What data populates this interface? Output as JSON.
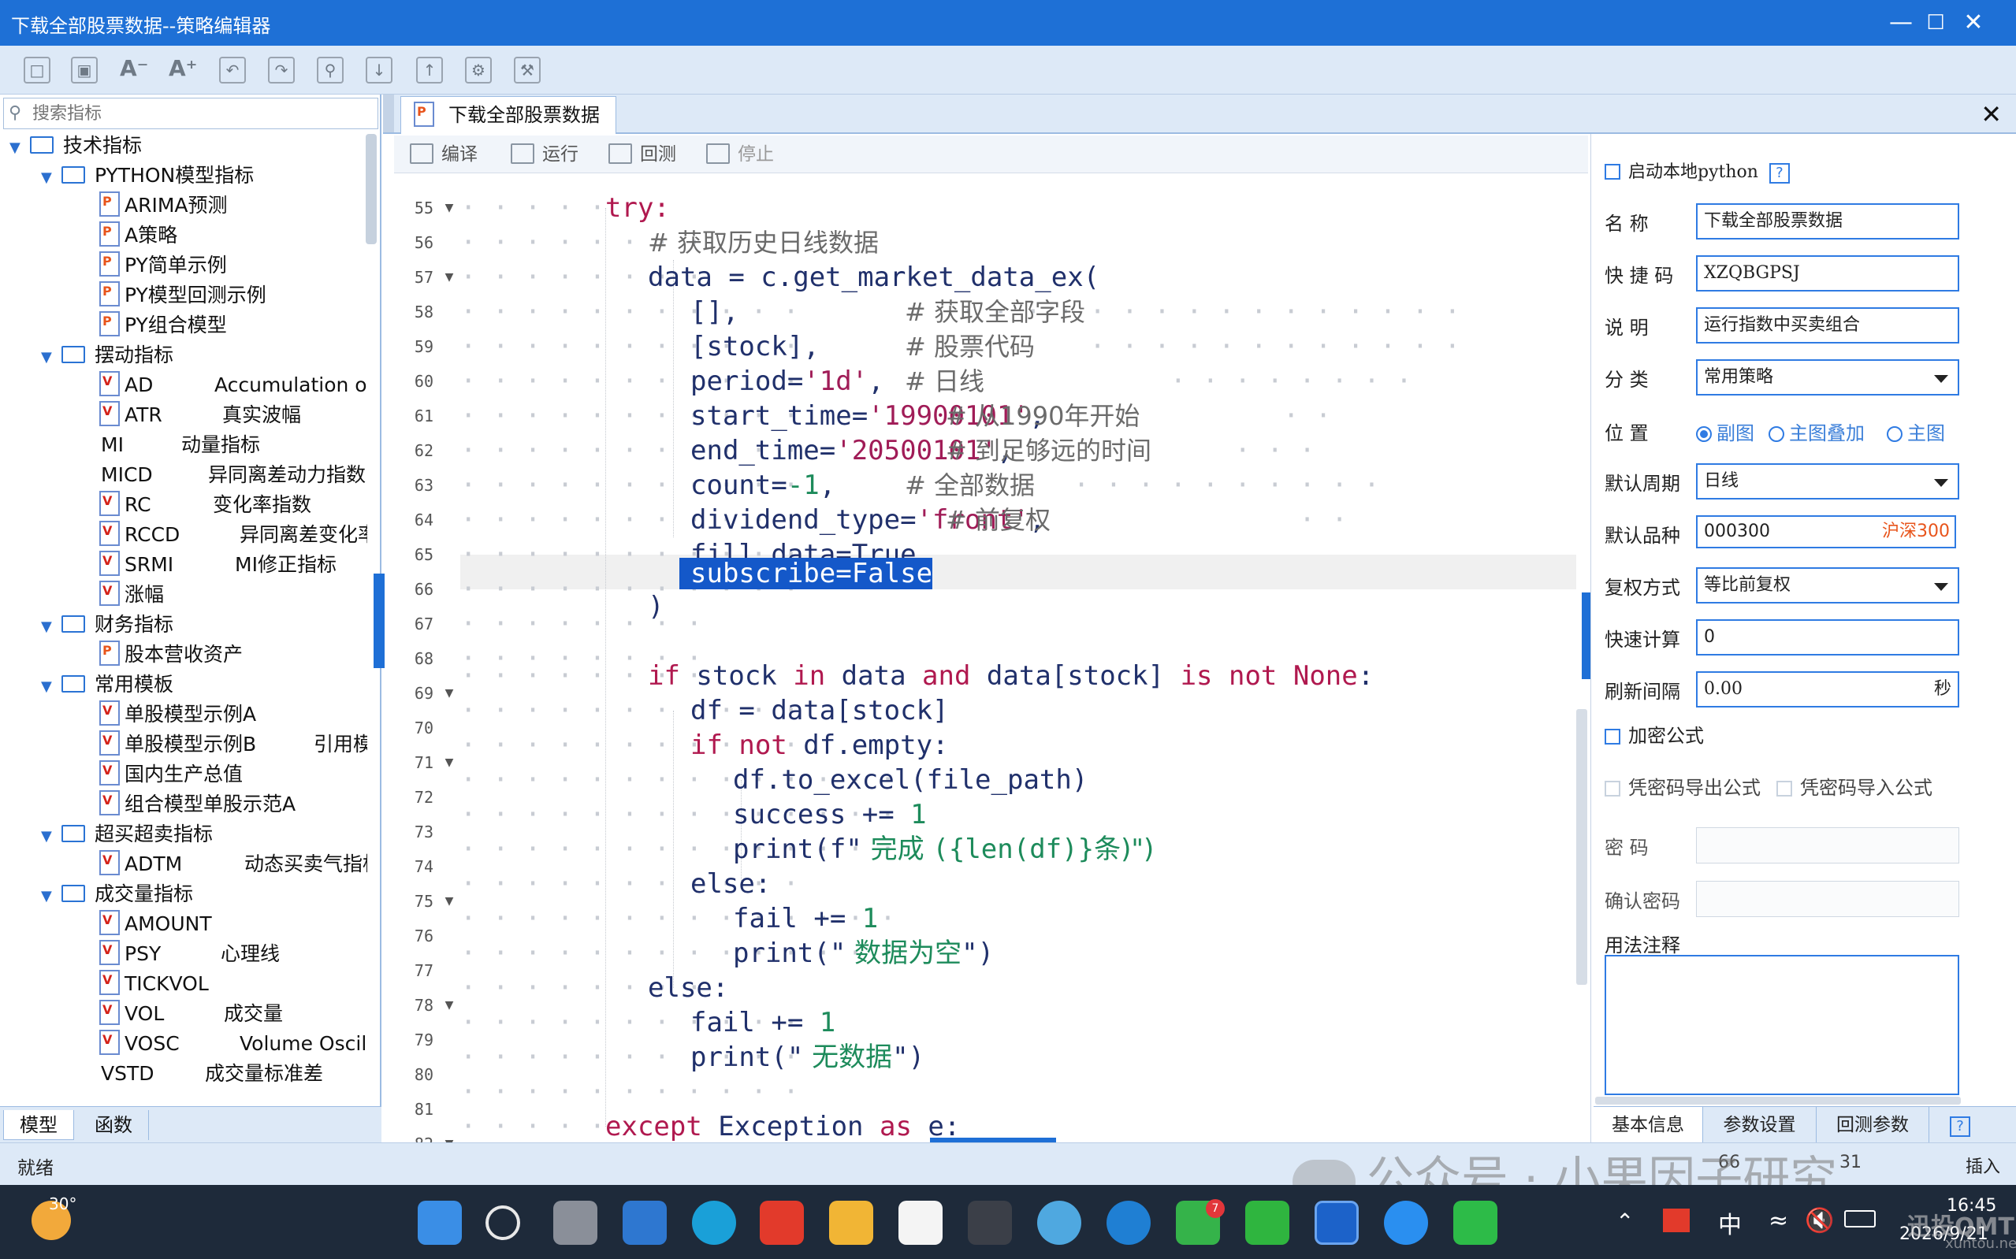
{
  "window": {
    "title": "下载全部股票数据--策略编辑器"
  },
  "toolbar": {
    "icons": [
      "save-icon",
      "save-all-icon",
      "font-decrease-icon",
      "font-increase-icon",
      "undo-icon",
      "redo-icon",
      "find-icon",
      "export-icon",
      "import-icon",
      "settings-icon",
      "tools-icon"
    ]
  },
  "search": {
    "placeholder": "搜索指标"
  },
  "tree": {
    "root": "技术指标",
    "g1": "PYTHON模型指标",
    "g1i": [
      "ARIMA预测",
      "A策略",
      "PY简单示例",
      "PY模型回测示例",
      "PY组合模型"
    ],
    "g2": "摆动指标",
    "g2i": [
      [
        "AD",
        "Accumulation or"
      ],
      [
        "ATR",
        "真实波幅"
      ],
      [
        "MI",
        "动量指标"
      ],
      [
        "MICD",
        "异同离差动力指数"
      ],
      [
        "RC",
        "变化率指数"
      ],
      [
        "RCCD",
        "异同离差变化率"
      ],
      [
        "SRMI",
        "MI修正指标"
      ],
      [
        "涨幅",
        ""
      ]
    ],
    "g3": "财务指标",
    "g3i": [
      "股本营收资产"
    ],
    "g4": "常用模板",
    "g4i": [
      [
        "单股模型示例A",
        ""
      ],
      [
        "单股模型示例B",
        "引用模"
      ],
      [
        "国内生产总值",
        ""
      ],
      [
        "组合模型单股示范A",
        ""
      ]
    ],
    "g5": "超买超卖指标",
    "g5i": [
      [
        "ADTM",
        "动态买卖气指标"
      ]
    ],
    "g6": "成交量指标",
    "g6i": [
      [
        "AMOUNT",
        ""
      ],
      [
        "PSY",
        "心理线"
      ],
      [
        "TICKVOL",
        ""
      ],
      [
        "VOL",
        "成交量"
      ],
      [
        "VOSC",
        "Volume Oscilla"
      ],
      [
        "VSTD",
        "成交量标准差"
      ]
    ]
  },
  "left_tabs": [
    "模型",
    "函数"
  ],
  "doc_tab": "下载全部股票数据",
  "editor_toolbar": [
    "编译",
    "运行",
    "回测",
    "停止"
  ],
  "code": {
    "line_numbers": [
      "55",
      "56",
      "57",
      "58",
      "59",
      "60",
      "61",
      "62",
      "63",
      "64",
      "65",
      "66",
      "67",
      "68",
      "69",
      "70",
      "71",
      "72",
      "73",
      "74",
      "75",
      "76",
      "77",
      "78",
      "79",
      "80",
      "81",
      "82"
    ],
    "l55": "try:",
    "l56": "# 获取历史日线数据",
    "l57a": "data = c.get_market_data_ex(",
    "l58a": "[],",
    "l58c": "# 获取全部字段",
    "l59a": "[stock],",
    "l59c": "# 股票代码",
    "l60a": "period=",
    "l60s": "'1d'",
    "l60b": ",",
    "l60c": "# 日线",
    "l61a": "start_time=",
    "l61s": "'19900101'",
    "l61b": ",",
    "l61c": "# 从1990年开始",
    "l62a": "end_time=",
    "l62s": "'20500101'",
    "l62b": ",",
    "l62c": "# 到足够远的时间",
    "l63a": "count=",
    "l63n": "-1",
    "l63b": ",",
    "l63c": "# 全部数据",
    "l64a": "dividend_type=",
    "l64s": "'front'",
    "l64b": ",",
    "l64c": "# 前复权",
    "l65a": "fill_data=True,",
    "l66": "subscribe=False",
    "l67": ")",
    "l69k1": "if",
    "l69a": " stock ",
    "l69k2": "in",
    "l69b": " data ",
    "l69k3": "and",
    "l69c": " data[stock] ",
    "l69k4": "is not None",
    ":": ":",
    "l70": "df = data[stock]",
    "l71k": "if not",
    "l71a": " df.empty:",
    "l72": "df.to_excel(file_path)",
    "l73a": "success += ",
    "l73n": "1",
    "l74a": "print(f\"",
    "l74s": " 完成 ",
    "l74b": "({len(df)}",
    "l74s2": "条)\")",
    "l75": "else:",
    "l76a": "fail += ",
    "l76n": "1",
    "l77a": "print(\"",
    "l77s": " 数据为空",
    "l77b": "\")",
    "l78": "else:",
    "l79a": "fail += ",
    "l79n": "1",
    "l80a": "print(\"",
    "l80s": " 无数据",
    "l80b": "\")",
    "l82k": "except",
    "l82a": " Exception ",
    "l82k2": "as",
    "l82b": " e:"
  },
  "props": {
    "local_python": "启动本地python",
    "help": "?",
    "name_label": "名    称",
    "name_value": "下载全部股票数据",
    "short_label": "快 捷 码",
    "short_value": "XZQBGPSJ",
    "desc_label": "说    明",
    "desc_value": "运行指数中买卖组合",
    "cat_label": "分    类",
    "cat_value": "常用策略",
    "pos_label": "位    置",
    "pos_options": [
      "副图",
      "主图叠加",
      "主图"
    ],
    "period_label": "默认周期",
    "period_value": "日线",
    "symbol_label": "默认品种",
    "symbol_value": "000300",
    "symbol_name": "沪深300",
    "adj_label": "复权方式",
    "adj_value": "等比前复权",
    "fast_label": "快速计算",
    "fast_value": "0",
    "refresh_label": "刷新间隔",
    "refresh_value": "0.00",
    "refresh_unit": "秒",
    "encrypt_label": "加密公式",
    "export_pw": "凭密码导出公式",
    "import_pw": "凭密码导入公式",
    "pw_label": "密    码",
    "pw2_label": "确认密码",
    "notes_label": "用法注释"
  },
  "right_tabs": [
    "基本信息",
    "参数设置",
    "回测参数"
  ],
  "status": {
    "left": "就绪",
    "line": "66",
    "col": "31",
    "mode": "插入"
  },
  "watermark": "公众号 · 小果因子研究",
  "taskbar": {
    "weather": "30°",
    "ime": "中",
    "time": "16:45",
    "date": "2026/9/21",
    "badge": "7",
    "brand": "迅投QMT",
    "site": "xuntou.net"
  },
  "colors": {
    "accent": "#1e70d6",
    "keyword": "#b0194f",
    "string": "#a01c57",
    "number": "#1d8b5b",
    "selection": "#1458c9"
  }
}
